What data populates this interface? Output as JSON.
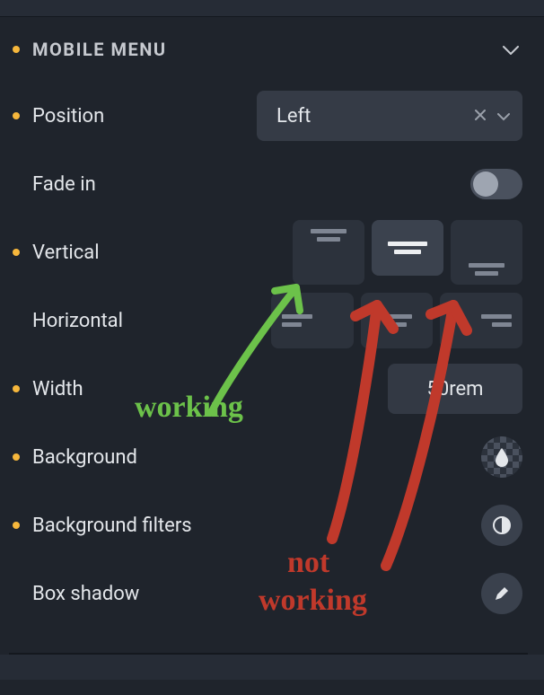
{
  "section": {
    "title": "MOBILE MENU"
  },
  "fields": {
    "position": {
      "label": "Position",
      "value": "Left"
    },
    "fade_in": {
      "label": "Fade in",
      "value": false
    },
    "vertical": {
      "label": "Vertical",
      "options": [
        "top",
        "middle",
        "bottom"
      ],
      "selected": "middle"
    },
    "horizontal": {
      "label": "Horizontal",
      "options": [
        "left",
        "center",
        "right"
      ]
    },
    "width": {
      "label": "Width",
      "value": "50rem"
    },
    "background": {
      "label": "Background"
    },
    "background_filters": {
      "label": "Background filters"
    },
    "box_shadow": {
      "label": "Box shadow"
    }
  },
  "annotations": {
    "working": "working",
    "not_working_1": "not",
    "not_working_2": "working"
  },
  "colors": {
    "accent": "#f6b73c",
    "panel": "#1f242c",
    "control": "#353b46"
  }
}
